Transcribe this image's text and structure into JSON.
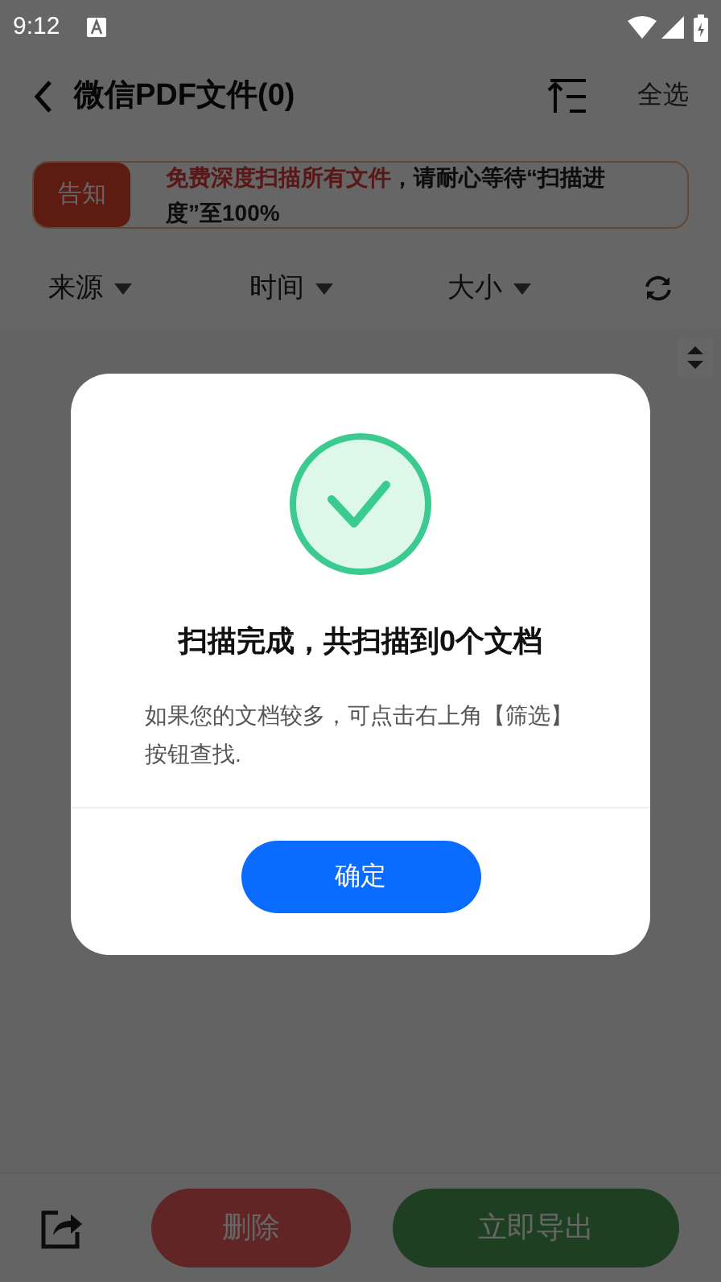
{
  "status_bar": {
    "time": "9:12"
  },
  "header": {
    "title": "微信PDF文件(0)",
    "select_all": "全选"
  },
  "notice": {
    "tag": "告知",
    "highlight": "免费深度扫描所有文件",
    "text": "，请耐心等待“扫描进度”至100%"
  },
  "filters": [
    {
      "label": "来源"
    },
    {
      "label": "时间"
    },
    {
      "label": "大小"
    }
  ],
  "dialog": {
    "title": "扫描完成，共扫描到0个文档",
    "message": "如果您的文档较多，可点击右上角【筛选】按钮查找.",
    "button": "确定"
  },
  "bottom_bar": {
    "delete": "删除",
    "export": "立即导出"
  }
}
